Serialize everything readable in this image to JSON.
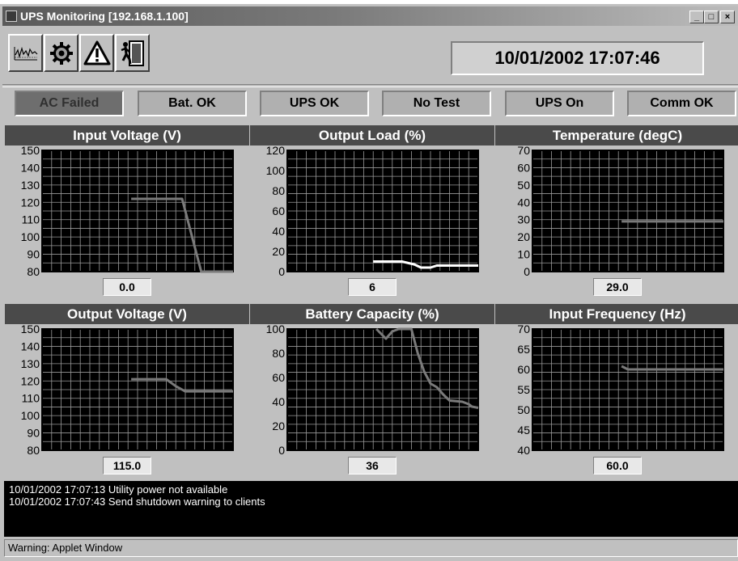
{
  "window": {
    "title": "UPS Monitoring [192.168.1.100]",
    "controls": [
      "_",
      "□",
      "×"
    ]
  },
  "toolbar": {
    "buttons": [
      {
        "icon": "graph-icon"
      },
      {
        "icon": "gear-icon"
      },
      {
        "icon": "warning-icon"
      },
      {
        "icon": "exit-door-icon"
      }
    ],
    "datetime": "10/01/2002 17:07:46"
  },
  "status": [
    {
      "label": "AC Failed",
      "alarm": true
    },
    {
      "label": "Bat. OK",
      "alarm": false
    },
    {
      "label": "UPS OK",
      "alarm": false
    },
    {
      "label": "No Test",
      "alarm": false
    },
    {
      "label": "UPS On",
      "alarm": false
    },
    {
      "label": "Comm OK",
      "alarm": false
    }
  ],
  "panels": [
    {
      "title": "Input Voltage (V)",
      "value": "0.0"
    },
    {
      "title": "Output Load (%)",
      "value": "6"
    },
    {
      "title": "Temperature (degC)",
      "value": "29.0"
    },
    {
      "title": "Output Voltage (V)",
      "value": "115.0"
    },
    {
      "title": "Battery Capacity (%)",
      "value": "36"
    },
    {
      "title": "Input Frequency (Hz)",
      "value": "60.0"
    }
  ],
  "chart_data": [
    {
      "type": "line",
      "title": "Input Voltage (V)",
      "ylim": [
        80,
        150
      ],
      "yticks": [
        80,
        90,
        100,
        110,
        120,
        130,
        140,
        150
      ],
      "grid": true,
      "x": [
        0,
        28,
        40,
        44,
        50,
        60
      ],
      "y": [
        null,
        122,
        122,
        122,
        80,
        80
      ],
      "color": "#7a7a7a"
    },
    {
      "type": "line",
      "title": "Output Load (%)",
      "ylim": [
        0,
        120
      ],
      "yticks": [
        0,
        20,
        40,
        60,
        80,
        100,
        120
      ],
      "grid": true,
      "x": [
        0,
        27,
        36,
        40,
        42,
        45,
        47,
        50,
        60
      ],
      "y": [
        null,
        10,
        10,
        7,
        4,
        4,
        6,
        6,
        6
      ],
      "color": "#ffffff"
    },
    {
      "type": "line",
      "title": "Temperature (degC)",
      "ylim": [
        0,
        70
      ],
      "yticks": [
        0,
        10,
        20,
        30,
        40,
        50,
        60,
        70
      ],
      "grid": true,
      "x": [
        0,
        28,
        60
      ],
      "y": [
        null,
        29,
        29
      ],
      "color": "#7a7a7a"
    },
    {
      "type": "line",
      "title": "Output Voltage (V)",
      "ylim": [
        80,
        150
      ],
      "yticks": [
        80,
        90,
        100,
        110,
        120,
        130,
        140,
        150
      ],
      "grid": true,
      "x": [
        0,
        28,
        39,
        42,
        45,
        60
      ],
      "y": [
        null,
        121,
        121,
        117,
        114,
        114
      ],
      "color": "#7a7a7a"
    },
    {
      "type": "line",
      "title": "Battery Capacity (%)",
      "ylim": [
        0,
        100
      ],
      "yticks": [
        0,
        20,
        40,
        60,
        80,
        100
      ],
      "grid": true,
      "x": [
        0,
        28,
        31,
        33,
        35,
        39,
        41,
        43,
        45,
        47,
        49,
        51,
        55,
        57,
        58,
        60
      ],
      "y": [
        null,
        100,
        92,
        98,
        100,
        100,
        80,
        65,
        55,
        52,
        46,
        41,
        40,
        38,
        36,
        35
      ],
      "color": "#7a7a7a"
    },
    {
      "type": "line",
      "title": "Input Frequency (Hz)",
      "ylim": [
        40,
        70
      ],
      "yticks": [
        40,
        45,
        50,
        55,
        60,
        65,
        70
      ],
      "grid": true,
      "x": [
        0,
        28,
        30,
        60
      ],
      "y": [
        null,
        60.8,
        60.0,
        60.0
      ],
      "color": "#7a7a7a"
    }
  ],
  "log": [
    "10/01/2002 17:07:13  Utility power not available",
    "10/01/2002 17:07:43  Send shutdown warning to clients"
  ],
  "statusbar": "Warning: Applet Window"
}
